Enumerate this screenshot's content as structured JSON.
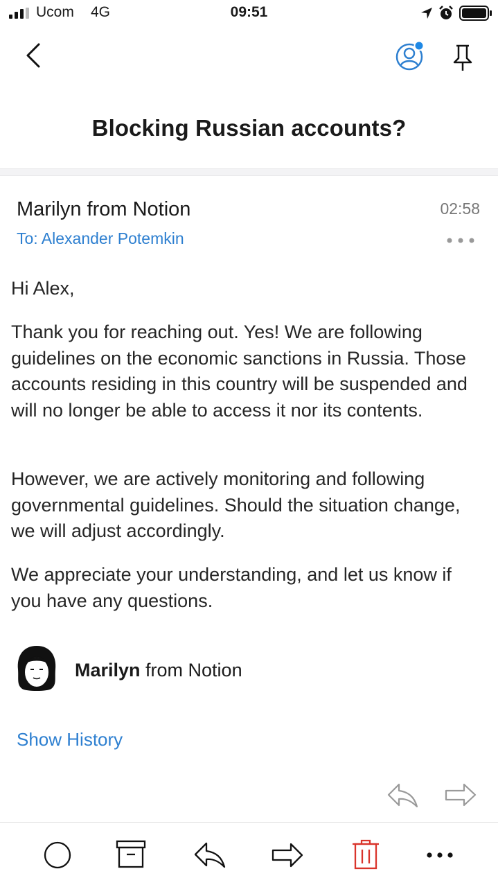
{
  "status_bar": {
    "carrier": "Ucom",
    "network": "4G",
    "time": "09:51",
    "icons": [
      "signal-bars-icon",
      "location-arrow-icon",
      "alarm-clock-icon",
      "battery-icon"
    ]
  },
  "nav": {
    "icons": [
      "chevron-left-icon",
      "contact-icon",
      "pin-icon"
    ],
    "accent_color": "#2d7fd0",
    "notification_dot_color": "#1e88e5"
  },
  "email": {
    "subject": "Blocking Russian accounts?",
    "sender": "Marilyn from Notion",
    "time": "02:58",
    "recipient": "To: Alexander Potemkin",
    "greeting": "Hi Alex,",
    "paragraphs": [
      "Thank you for reaching out. Yes! We are following guidelines on the economic sanctions in Russia. Those accounts residing in this country will be suspended and will no longer be able to access it nor its contents.",
      "However, we are actively monitoring and following governmental guidelines. Should the situation change, we will adjust accordingly.",
      "We appreciate your understanding, and let us know if you have any questions."
    ],
    "signature_name": "Marilyn",
    "signature_rest": " from Notion",
    "show_history": "Show History"
  },
  "toolbar": {
    "icons": [
      "circle-icon",
      "archive-icon",
      "reply-icon",
      "forward-icon",
      "trash-icon",
      "more-icon"
    ],
    "trash_color": "#d9342b"
  }
}
